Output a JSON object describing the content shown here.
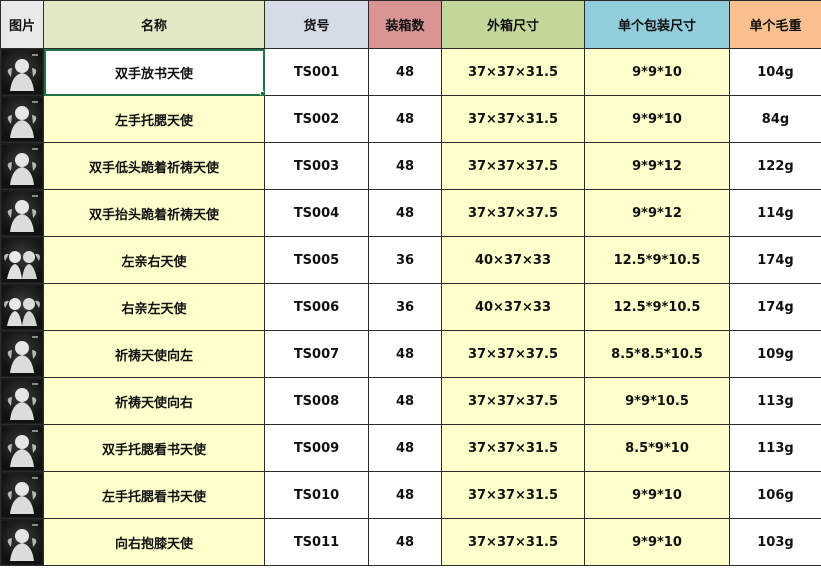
{
  "headers": {
    "picture": "图片",
    "name": "名称",
    "code": "货号",
    "qty": "装箱数",
    "outer_size": "外箱尺寸",
    "pack_size": "单个包装尺寸",
    "weight": "单个毛重"
  },
  "header_colors": {
    "name": "#e2e8c4",
    "code": "#d6dce5",
    "qty": "#d99594",
    "outer_size": "#c4d79b",
    "pack_size": "#92cddc",
    "weight": "#fabf8f"
  },
  "selected_cell": "B2",
  "rows": [
    {
      "name": "双手放书天使",
      "code": "TS001",
      "qty": "48",
      "outer_size": "37×37×31.5",
      "pack_size": "9*9*10",
      "weight": "104g",
      "thumbnail_icon": "angel-figurine-icon"
    },
    {
      "name": "左手托腮天使",
      "code": "TS002",
      "qty": "48",
      "outer_size": "37×37×31.5",
      "pack_size": "9*9*10",
      "weight": "84g",
      "thumbnail_icon": "angel-figurine-icon"
    },
    {
      "name": "双手低头跪着祈祷天使",
      "code": "TS003",
      "qty": "48",
      "outer_size": "37×37×37.5",
      "pack_size": "9*9*12",
      "weight": "122g",
      "thumbnail_icon": "angel-figurine-icon"
    },
    {
      "name": "双手抬头跪着祈祷天使",
      "code": "TS004",
      "qty": "48",
      "outer_size": "37×37×37.5",
      "pack_size": "9*9*12",
      "weight": "114g",
      "thumbnail_icon": "angel-figurine-icon"
    },
    {
      "name": "左亲右天使",
      "code": "TS005",
      "qty": "36",
      "outer_size": "40×37×33",
      "pack_size": "12.5*9*10.5",
      "weight": "174g",
      "thumbnail_icon": "angel-pair-icon"
    },
    {
      "name": "右亲左天使",
      "code": "TS006",
      "qty": "36",
      "outer_size": "40×37×33",
      "pack_size": "12.5*9*10.5",
      "weight": "174g",
      "thumbnail_icon": "angel-pair-icon"
    },
    {
      "name": "祈祷天使向左",
      "code": "TS007",
      "qty": "48",
      "outer_size": "37×37×37.5",
      "pack_size": "8.5*8.5*10.5",
      "weight": "109g",
      "thumbnail_icon": "angel-figurine-icon"
    },
    {
      "name": "祈祷天使向右",
      "code": "TS008",
      "qty": "48",
      "outer_size": "37×37×37.5",
      "pack_size": "9*9*10.5",
      "weight": "113g",
      "thumbnail_icon": "angel-figurine-icon"
    },
    {
      "name": "双手托腮看书天使",
      "code": "TS009",
      "qty": "48",
      "outer_size": "37×37×31.5",
      "pack_size": "8.5*9*10",
      "weight": "113g",
      "thumbnail_icon": "angel-figurine-icon"
    },
    {
      "name": "左手托腮看书天使",
      "code": "TS010",
      "qty": "48",
      "outer_size": "37×37×31.5",
      "pack_size": "9*9*10",
      "weight": "106g",
      "thumbnail_icon": "angel-figurine-icon"
    },
    {
      "name": "向右抱膝天使",
      "code": "TS011",
      "qty": "48",
      "outer_size": "37×37×31.5",
      "pack_size": "9*9*10",
      "weight": "103g",
      "thumbnail_icon": "angel-figurine-icon"
    }
  ]
}
